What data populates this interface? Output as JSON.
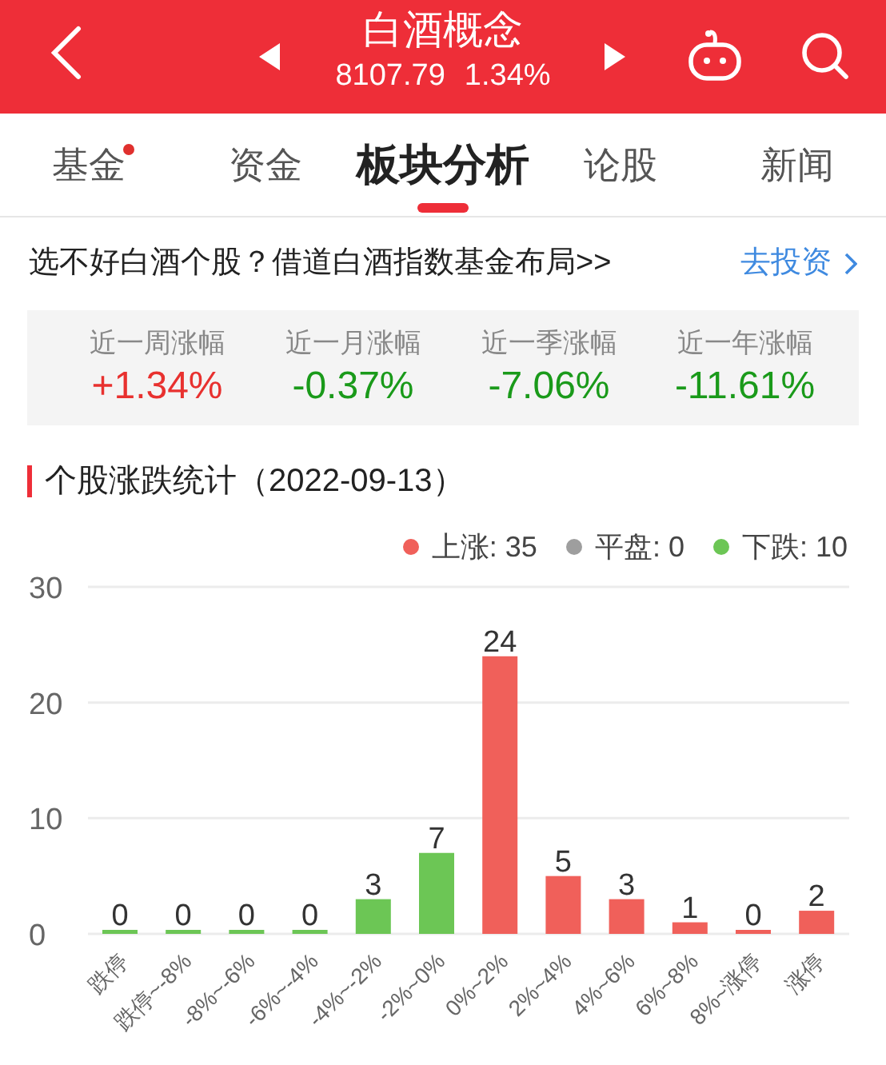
{
  "header": {
    "title": "白酒概念",
    "price": "8107.79",
    "change": "1.34%"
  },
  "tabs": [
    {
      "label": "基金",
      "selected": false,
      "dot": true
    },
    {
      "label": "资金",
      "selected": false,
      "dot": false
    },
    {
      "label": "板块分析",
      "selected": true,
      "dot": false
    },
    {
      "label": "论股",
      "selected": false,
      "dot": false
    },
    {
      "label": "新闻",
      "selected": false,
      "dot": false
    }
  ],
  "banner": {
    "text": "选不好白酒个股？借道白酒指数基金布局>>",
    "link": "去投资"
  },
  "stats": [
    {
      "label": "近一周涨幅",
      "value": "+1.34%",
      "color": "#e8312f"
    },
    {
      "label": "近一月涨幅",
      "value": "-0.37%",
      "color": "#1a9a1a"
    },
    {
      "label": "近一季涨幅",
      "value": "-7.06%",
      "color": "#1a9a1a"
    },
    {
      "label": "近一年涨幅",
      "value": "-11.61%",
      "color": "#1a9a1a"
    }
  ],
  "section_title": "个股涨跌统计（2022-09-13）",
  "legend": [
    {
      "label": "上涨: 35",
      "color": "#f0605a"
    },
    {
      "label": "平盘: 0",
      "color": "#9e9e9e"
    },
    {
      "label": "下跌: 10",
      "color": "#6cc655"
    }
  ],
  "chart_data": {
    "type": "bar",
    "data_labels": true,
    "categories": [
      "跌停",
      "跌停~-8%",
      "-8%~-6%",
      "-6%~-4%",
      "-4%~-2%",
      "-2%~0%",
      "0%~2%",
      "2%~4%",
      "4%~6%",
      "6%~8%",
      "8%~涨停",
      "涨停"
    ],
    "series": [
      {
        "color": "#6cc655",
        "values": [
          0,
          0,
          0,
          0,
          3,
          7,
          null,
          null,
          null,
          null,
          null,
          null
        ]
      },
      {
        "color": "#f0605a",
        "values": [
          null,
          null,
          null,
          null,
          null,
          null,
          24,
          5,
          3,
          1,
          0,
          2
        ]
      }
    ],
    "ylim": [
      0,
      30
    ],
    "yticks": [
      0,
      10,
      20,
      30
    ]
  }
}
